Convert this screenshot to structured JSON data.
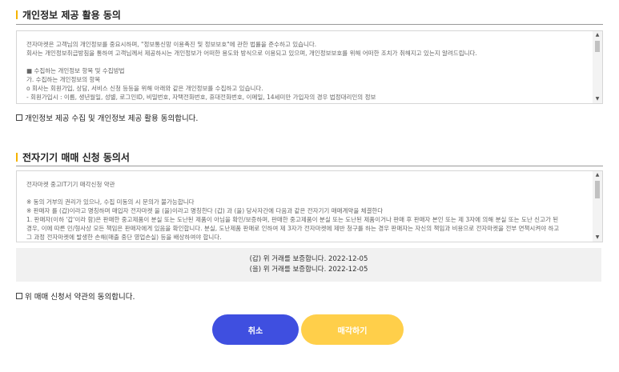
{
  "privacy": {
    "title": "개인정보 제공 활용 동의",
    "lines": [
      "전자마켓은 고객님의 개인정보를 중요시하며, \"정보통신망 이용촉진 및 정보보호\"에 관한 법률을 준수하고 있습니다.",
      "회사는 개인정보취급방침을 통하여 고객님께서 제공하시는 개인정보가 어떠한 용도와 방식으로 이용되고 있으며, 개인정보보호를 위해 어떠한 조치가 취해지고 있는지 알려드립니다.",
      "",
      "■ 수집하는 개인정보 항목 및 수집방법",
      "가. 수집하는 개인정보의 항목",
      "o 회사는 회원가입, 상담, 서비스 신청 등등을 위해 아래와 같은 개인정보를 수집하고 있습니다.",
      "- 회원가입시 : 이름, 생년월일, 성별, 로그인ID, 비밀번호, 자택전화번호, 휴대전화번호, 이메일, 14세미만 가입자의 경우 법정대리인의 정보"
    ],
    "agree_label": "개인정보 제공 수집 및 개인정보 제공 활용 동의합니다."
  },
  "trade": {
    "title": "전자기기 매매 신청 동의서",
    "lines": [
      "전자마켓 중고IT기기 매각신청 약관",
      "",
      "※ 동의 거부의 권리가 있으나, 수집 미동의 시 문의가 불가능합니다",
      "※ 판매자 를 (갑)이라고 명칭하며 매입자 전자마켓 을 (을)이라고 명칭한다 (갑) 과 (을) 당사자간에 다음과 같은 전자기기 매매계약을 체결한다",
      "1. 판매자(이하 '갑'이라 함)은 판매한 중고제품이 분실 또는 도난된 제품이 아님을 확인/보증하며, 판매한 중고제품이 분실 또는 도난된 제품이거나 판매 후 판매자 본인 또는 제 3자에 의해 분실 또는 도난 신고가 된",
      "경우, 이에 따른 민/형사상 모든 책임은 판매자에게 있음을 확인합니다. 분실, 도난제품 판매로 인하여 제 3자가 전자마켓에 제반 청구를 하는 경우 판매자는 자신의 책임과 비용으로 전자마켓을 전부 면책시켜야 하고",
      "그 과정 전자마켓에 발생한 손해(매출 중단 영업손실) 등을 배상하여야 합니다."
    ],
    "guarantee": {
      "line1": "(갑) 위 거래를 보증합니다. 2022-12-05",
      "line2": "(을) 위 거래를 보증합니다. 2022-12-05"
    },
    "agree_label": "위 매매 신청서 약관의 동의합니다."
  },
  "buttons": {
    "cancel": "취소",
    "sell": "매각하기"
  },
  "colors": {
    "accent_yellow": "#ffcf4a",
    "cancel_blue": "#3f4fe0",
    "title_bar": "#f5b400"
  }
}
